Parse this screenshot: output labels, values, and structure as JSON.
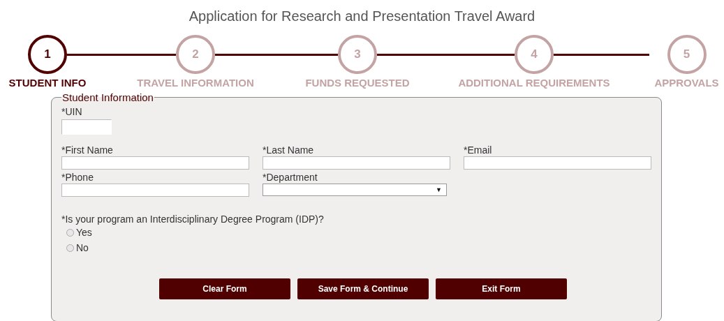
{
  "title": "Application for Research and Presentation Travel Award",
  "steps": [
    {
      "number": "1",
      "label": "STUDENT INFO",
      "selected": true
    },
    {
      "number": "2",
      "label": "TRAVEL INFORMATION",
      "selected": false
    },
    {
      "number": "3",
      "label": "FUNDS REQUESTED",
      "selected": false
    },
    {
      "number": "4",
      "label": "ADDITIONAL REQUIREMENTS",
      "selected": false
    },
    {
      "number": "5",
      "label": "APPROVALS",
      "selected": false
    }
  ],
  "section": {
    "legend": "Student Information",
    "field_rows": [
      [
        {
          "label": "*UIN",
          "kind": "short"
        }
      ],
      [
        {
          "label": "*First Name",
          "kind": "text"
        },
        {
          "label": "*Last Name",
          "kind": "text"
        },
        {
          "label": "*Email",
          "kind": "text"
        }
      ],
      [
        {
          "label": "*Phone",
          "kind": "text"
        },
        {
          "label": "*Department",
          "kind": "select",
          "arrow": "▼"
        }
      ]
    ],
    "question": "*Is your program an Interdisciplinary Degree Program (IDP)?",
    "options": [
      {
        "label": "Yes",
        "selected": false
      },
      {
        "label": "No",
        "selected": false
      }
    ],
    "buttons": [
      "Clear Form",
      "Save Form & Continue",
      "Exit Form"
    ]
  }
}
